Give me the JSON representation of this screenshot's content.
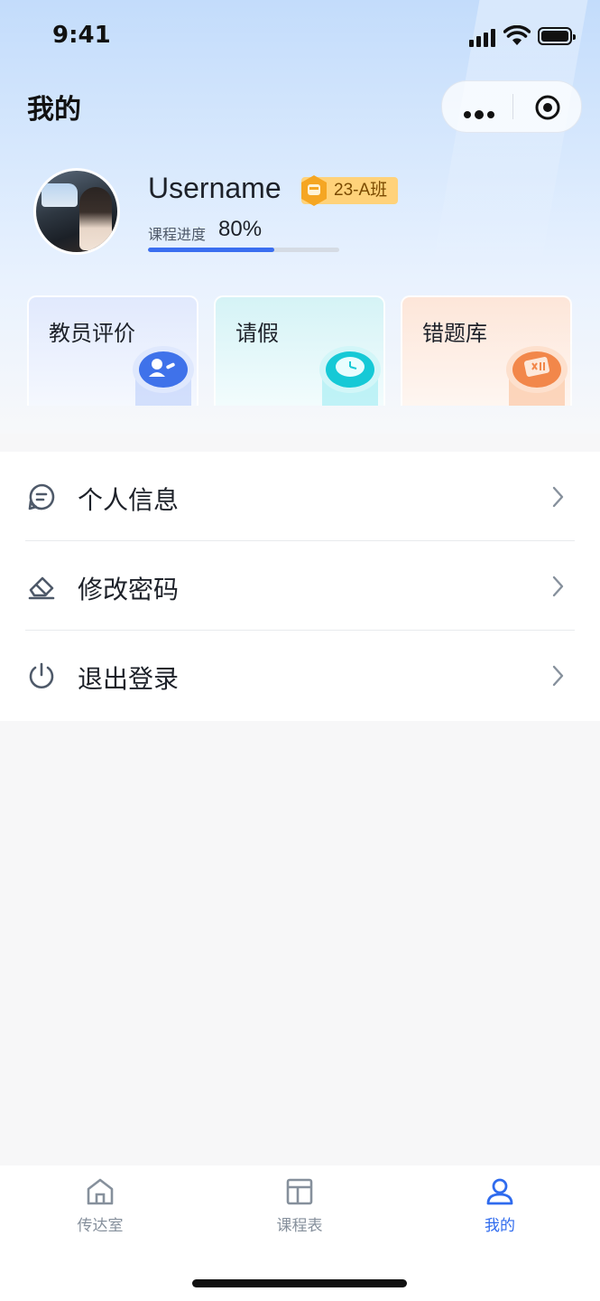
{
  "status_bar": {
    "time": "9:41"
  },
  "header": {
    "title": "我的"
  },
  "profile": {
    "username": "Username",
    "class_badge": "23-A班",
    "progress_label": "课程进度",
    "progress_text": "80%",
    "progress_fraction": 0.66
  },
  "quick_cards": [
    {
      "label": "教员评价",
      "icon": "teacher-review-icon"
    },
    {
      "label": "请假",
      "icon": "leave-clock-icon"
    },
    {
      "label": "错题库",
      "icon": "wrong-questions-icon"
    }
  ],
  "menu": [
    {
      "label": "个人信息",
      "icon": "chat-info-icon"
    },
    {
      "label": "修改密码",
      "icon": "eraser-icon"
    },
    {
      "label": "退出登录",
      "icon": "power-icon"
    }
  ],
  "tabbar": [
    {
      "label": "传达室",
      "icon": "home-icon",
      "active": false
    },
    {
      "label": "课程表",
      "icon": "layout-icon",
      "active": false
    },
    {
      "label": "我的",
      "icon": "user-icon",
      "active": true
    }
  ],
  "colors": {
    "accent": "#2f6bee",
    "badge": "#ffd27a",
    "progress": "#3a6ef0"
  }
}
